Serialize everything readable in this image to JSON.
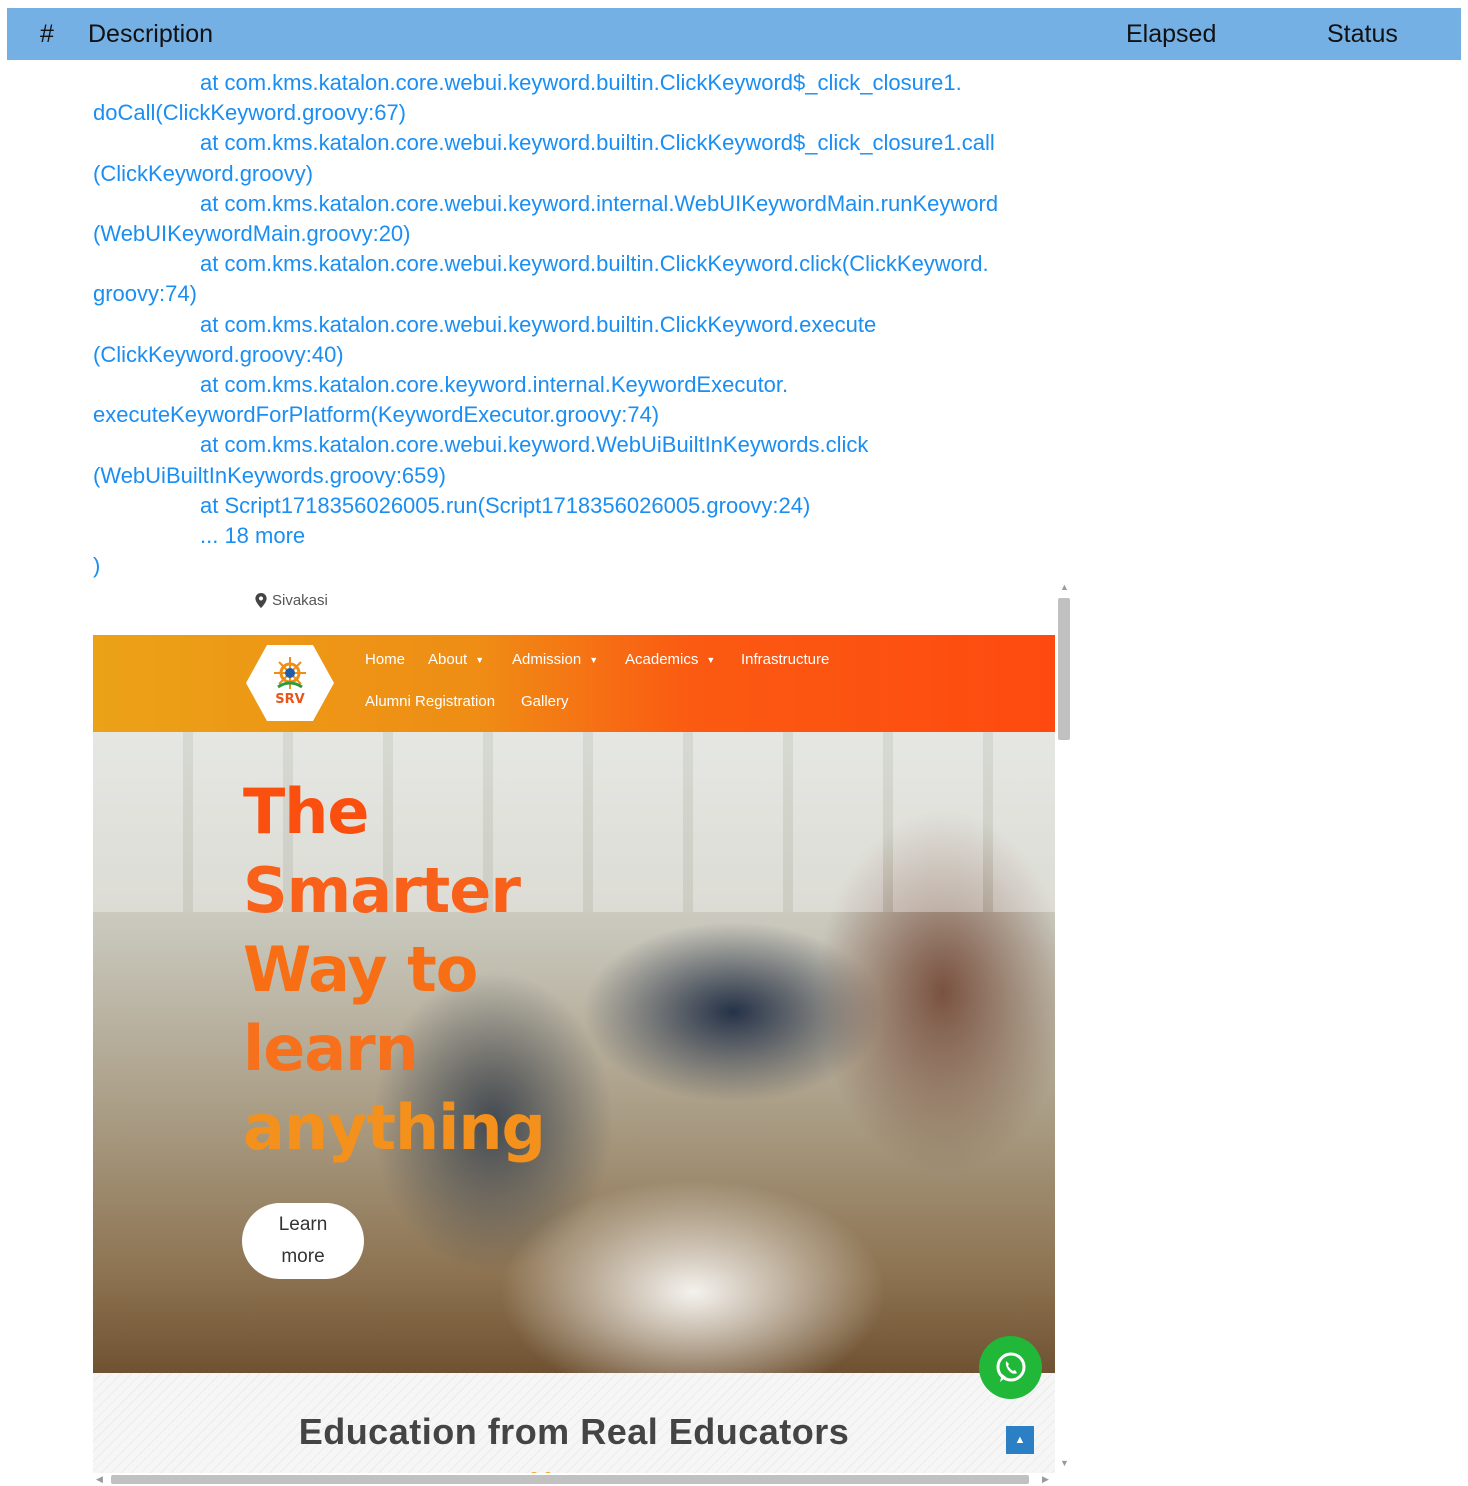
{
  "table_header": {
    "num": "#",
    "description": "Description",
    "elapsed": "Elapsed",
    "status": "Status"
  },
  "stack_trace": [
    {
      "text": "at com.kms.katalon.core.webui.keyword.builtin.ClickKeyword$_click_closure1.",
      "indent": true
    },
    {
      "text": "doCall(ClickKeyword.groovy:67)",
      "indent": false
    },
    {
      "text": "at com.kms.katalon.core.webui.keyword.builtin.ClickKeyword$_click_closure1.call",
      "indent": true
    },
    {
      "text": "(ClickKeyword.groovy)",
      "indent": false
    },
    {
      "text": "at com.kms.katalon.core.webui.keyword.internal.WebUIKeywordMain.runKeyword",
      "indent": true
    },
    {
      "text": "(WebUIKeywordMain.groovy:20)",
      "indent": false
    },
    {
      "text": "at com.kms.katalon.core.webui.keyword.builtin.ClickKeyword.click(ClickKeyword.",
      "indent": true
    },
    {
      "text": "groovy:74)",
      "indent": false
    },
    {
      "text": "at com.kms.katalon.core.webui.keyword.builtin.ClickKeyword.execute",
      "indent": true
    },
    {
      "text": "(ClickKeyword.groovy:40)",
      "indent": false
    },
    {
      "text": "at com.kms.katalon.core.keyword.internal.KeywordExecutor.",
      "indent": true
    },
    {
      "text": "executeKeywordForPlatform(KeywordExecutor.groovy:74)",
      "indent": false
    },
    {
      "text": "at com.kms.katalon.core.webui.keyword.WebUiBuiltInKeywords.click",
      "indent": true
    },
    {
      "text": "(WebUiBuiltInKeywords.groovy:659)",
      "indent": false
    },
    {
      "text": "at Script1718356026005.run(Script1718356026005.groovy:24)",
      "indent": true
    },
    {
      "text": "... 18 more",
      "indent": true
    },
    {
      "text": ")",
      "indent": false
    }
  ],
  "screenshot": {
    "location": "Sivakasi",
    "logo_text": "SRV",
    "nav": {
      "home": "Home",
      "about": "About",
      "admission": "Admission",
      "academics": "Academics",
      "infrastructure": "Infrastructure",
      "alumni": "Alumni Registration",
      "gallery": "Gallery"
    },
    "hero": {
      "line1": "The",
      "line2": "Smarter",
      "line3": "Way to",
      "line4": "learn",
      "line5": "anything",
      "button": "Learn more"
    },
    "section_title": "Education from Real Educators",
    "colors": {
      "nav_start": "#eba217",
      "nav_end": "#fe4a10",
      "accent": "#f0a21d",
      "whatsapp": "#21b83a"
    }
  }
}
